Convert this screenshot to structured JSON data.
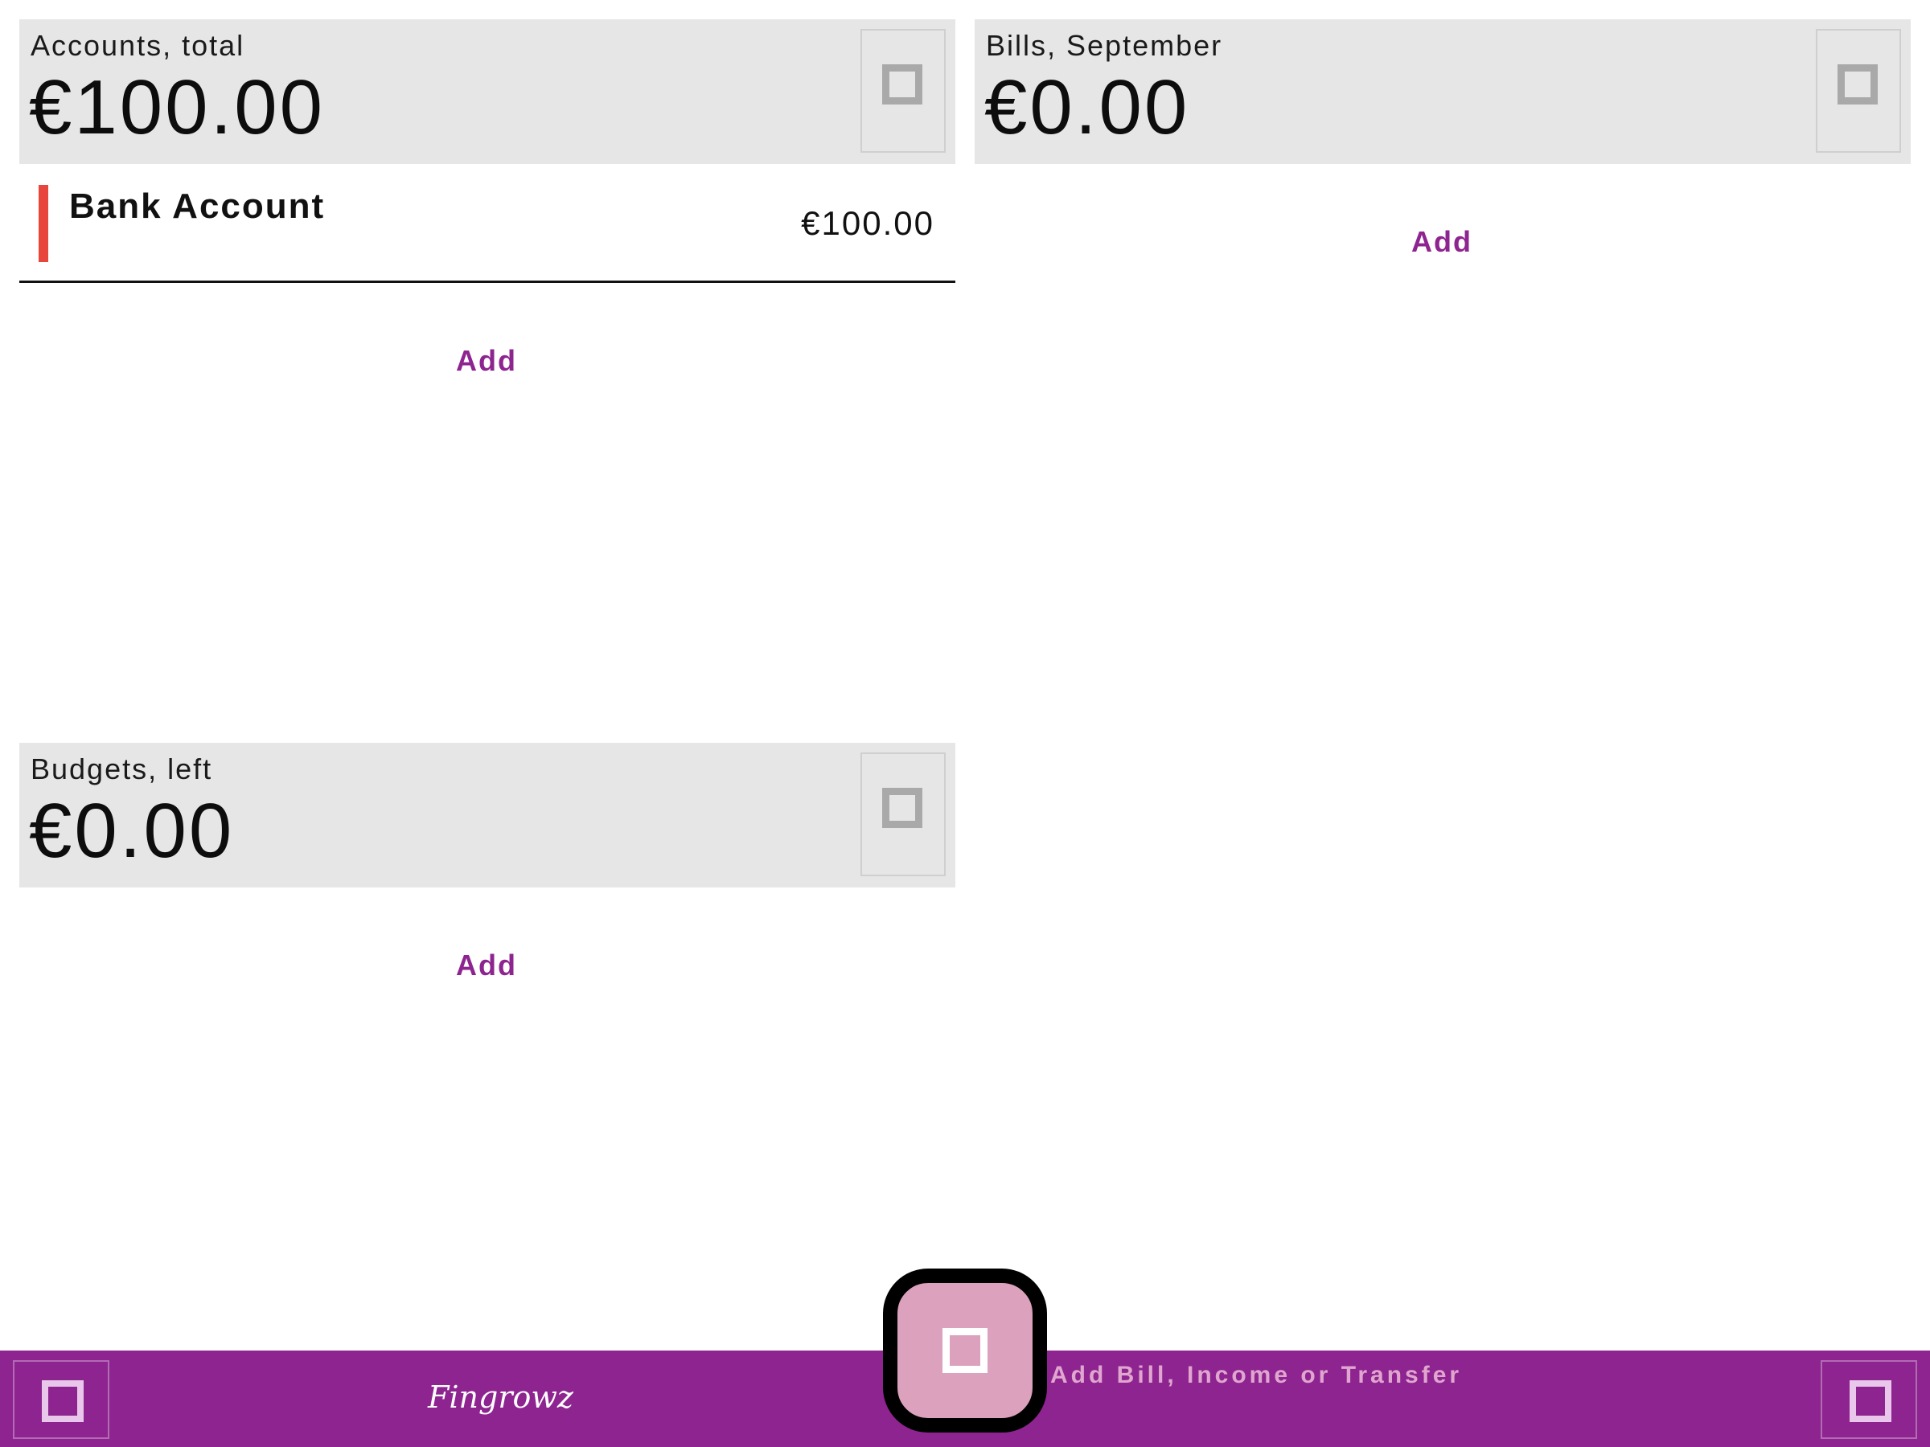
{
  "accounts": {
    "title": "Accounts, total",
    "amount": "€100.00",
    "items": [
      {
        "name": "Bank Account",
        "value": "€100.00",
        "color": "#e8453c"
      }
    ],
    "add_label": "Add"
  },
  "bills": {
    "title": "Bills, September",
    "amount": "€0.00",
    "add_label": "Add"
  },
  "budgets": {
    "title": "Budgets, left",
    "amount": "€0.00",
    "add_label": "Add"
  },
  "bottom_bar": {
    "logo": "Fingrowz",
    "fab_label": "Add Bill, Income or Transfer",
    "left_icon": "menu-square-icon",
    "right_icon": "menu-square-icon"
  },
  "colors": {
    "accent": "#8e2490",
    "panel_header": "#e6e6e6",
    "fab": "#dba1bd",
    "account_marker": "#e8453c"
  }
}
